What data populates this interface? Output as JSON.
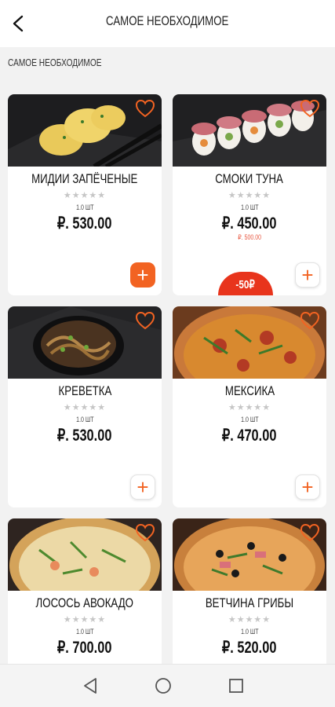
{
  "header": {
    "title": "САМОЕ НЕОБХОДИМОЕ",
    "back_icon": "chevron-left-icon"
  },
  "section_title": "САМОЕ НЕОБХОДИМОЕ",
  "colors": {
    "accent": "#f26322",
    "badge": "#e8341c",
    "old_price": "#e8563f"
  },
  "products": [
    {
      "name": "МИДИИ ЗАПЁЧЕНЫЕ",
      "rating": "★★★★★",
      "qty": "1.0 ШТ",
      "price": "₽. 530.00",
      "old_price": "",
      "badge": "",
      "add_style": "filled"
    },
    {
      "name": "СМОКИ ТУНА",
      "rating": "★★★★★",
      "qty": "1.0 ШТ",
      "price": "₽. 450.00",
      "old_price": "₽. 500.00",
      "badge": "-50₽",
      "add_style": "outline"
    },
    {
      "name": "КРЕВЕТКА",
      "rating": "★★★★★",
      "qty": "1.0 ШТ",
      "price": "₽. 530.00",
      "old_price": "",
      "badge": "",
      "add_style": "outline"
    },
    {
      "name": "МЕКСИКА",
      "rating": "★★★★★",
      "qty": "1.0 ШТ",
      "price": "₽. 470.00",
      "old_price": "",
      "badge": "",
      "add_style": "outline"
    },
    {
      "name": "ЛОСОСЬ АВОКАДО",
      "rating": "★★★★★",
      "qty": "1.0 ШТ",
      "price": "₽. 700.00",
      "old_price": "",
      "badge": "",
      "add_style": "outline"
    },
    {
      "name": "ВЕТЧИНА ГРИБЫ",
      "rating": "★★★★★",
      "qty": "1.0 ШТ",
      "price": "₽. 520.00",
      "old_price": "",
      "badge": "",
      "add_style": "outline"
    }
  ],
  "add_label": "+",
  "navbar": {
    "back": "triangle-back-icon",
    "home": "circle-home-icon",
    "recent": "square-recents-icon"
  }
}
